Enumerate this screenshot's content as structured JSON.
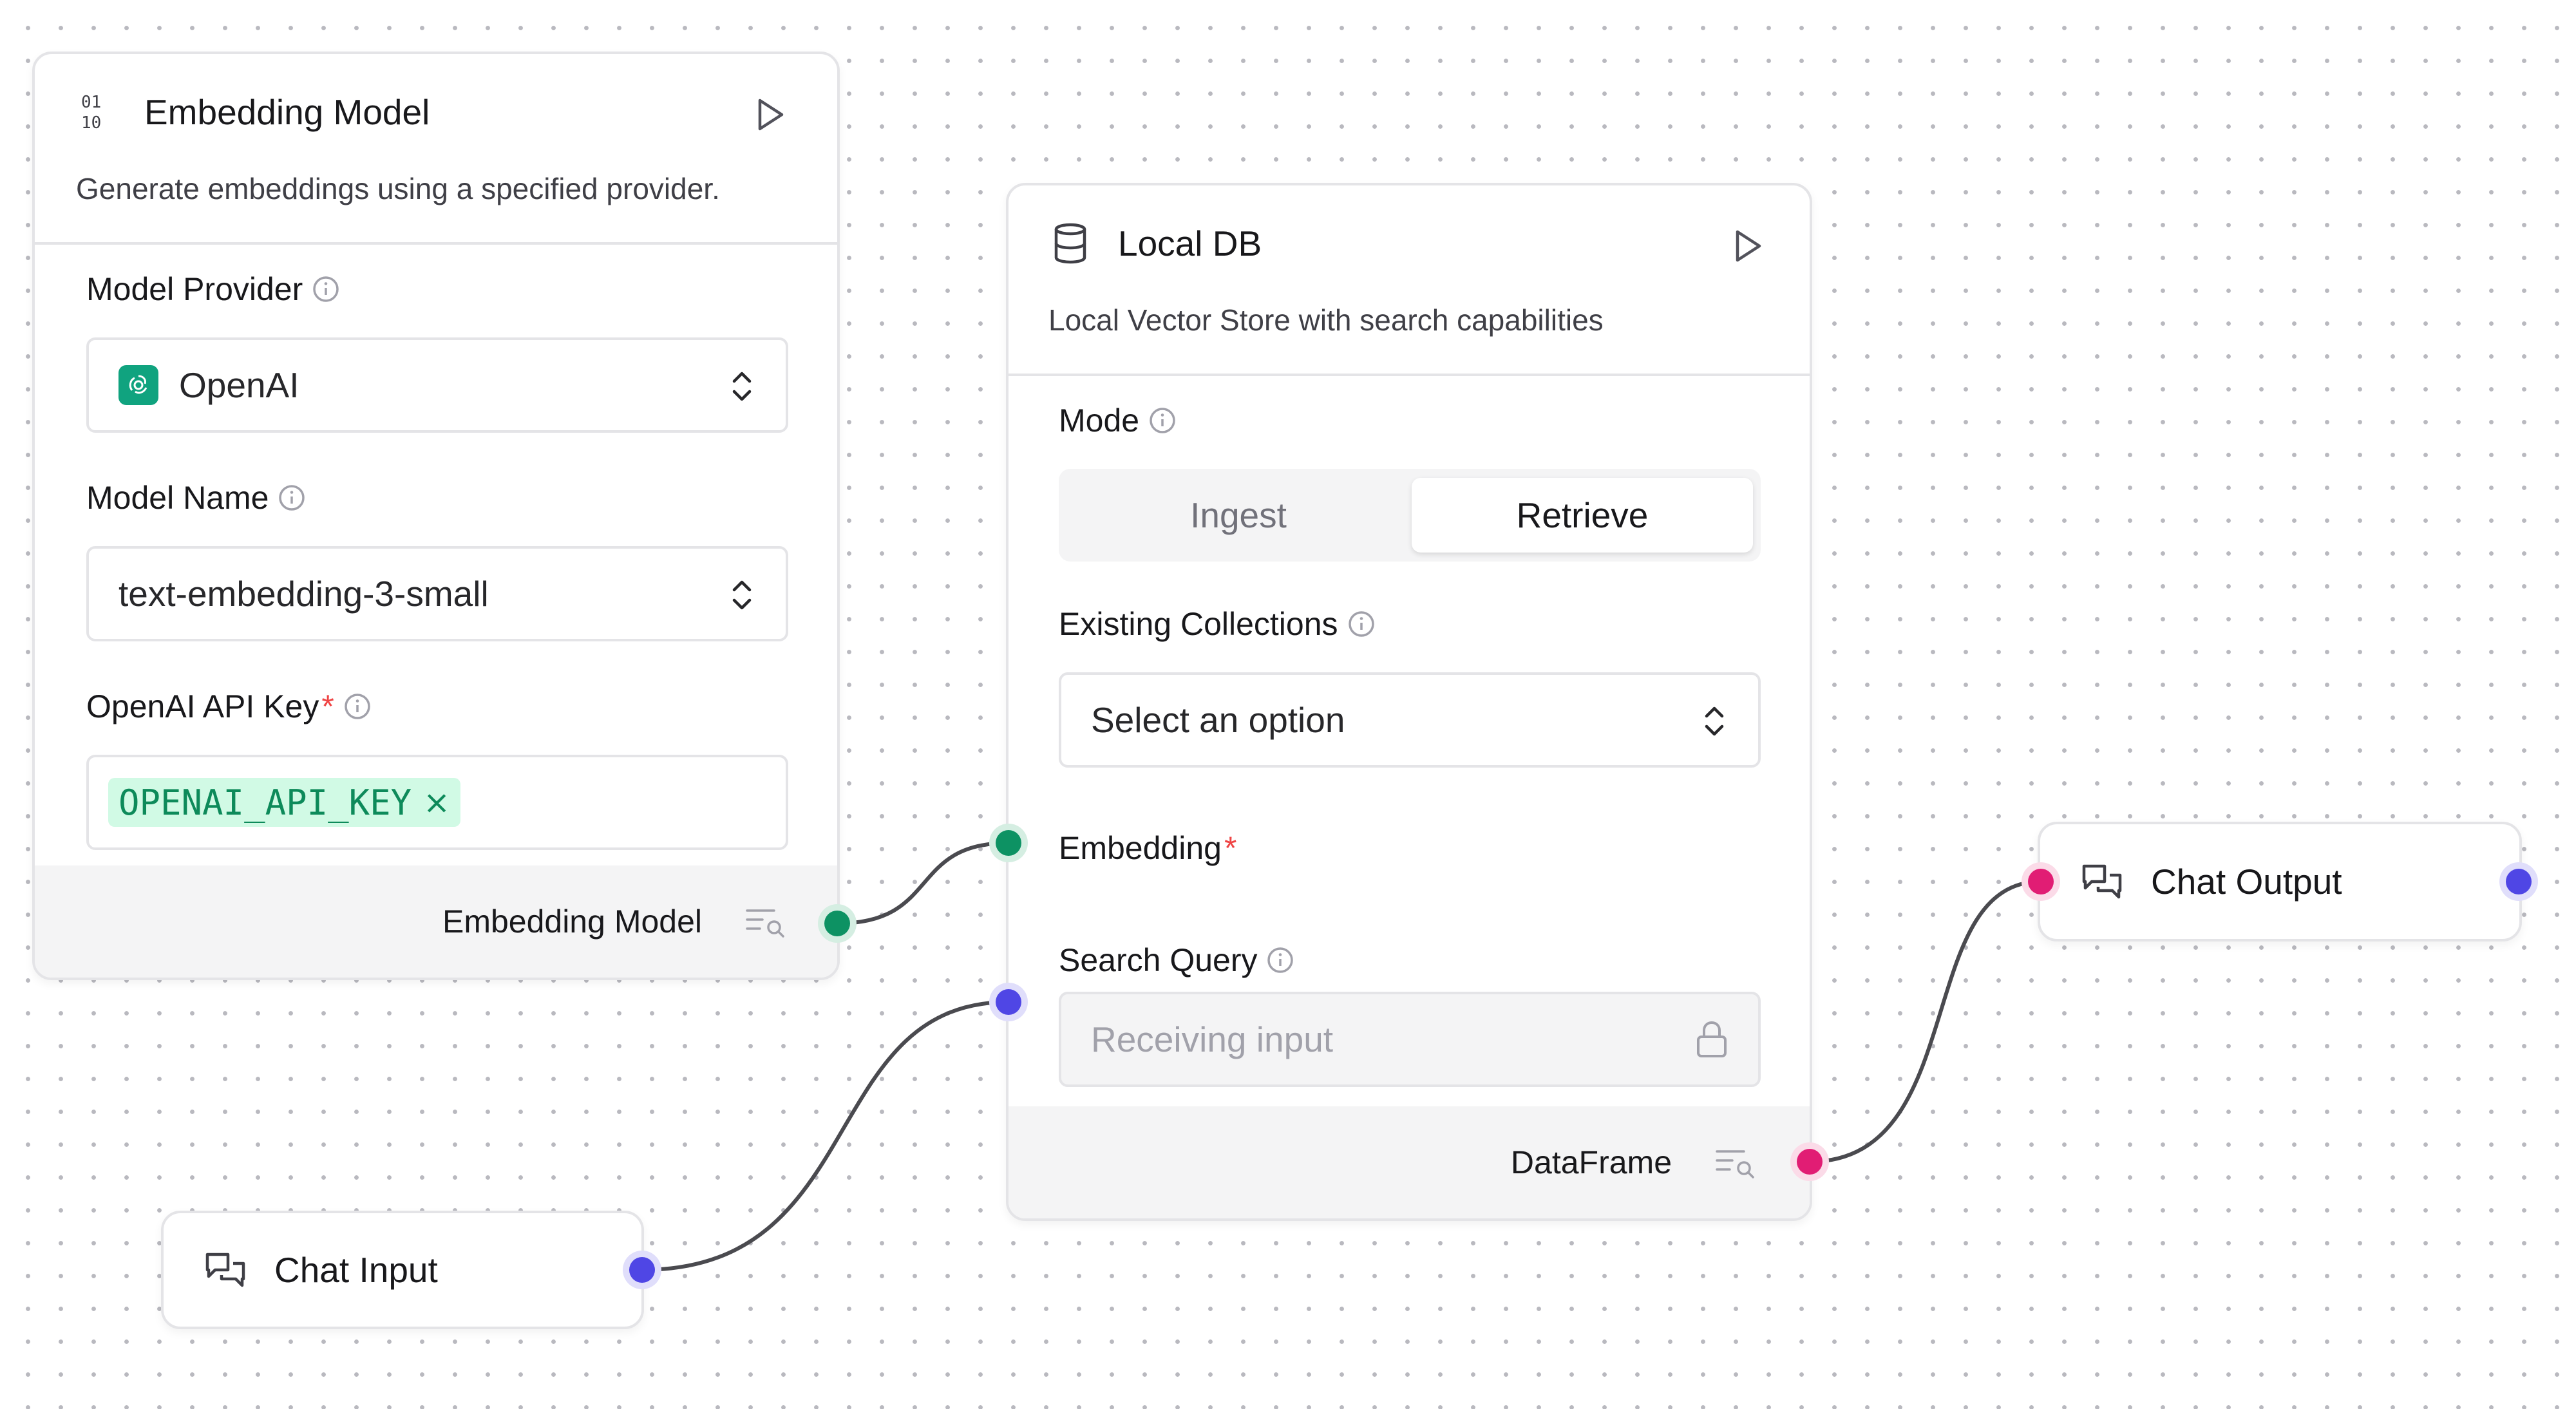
{
  "embedding_node": {
    "title": "Embedding Model",
    "description": "Generate embeddings using a specified provider.",
    "icon": "binary-icon",
    "fields": {
      "provider_label": "Model Provider",
      "provider_value": "OpenAI",
      "model_name_label": "Model Name",
      "model_name_value": "text-embedding-3-small",
      "api_key_label": "OpenAI API Key",
      "api_key_required": "*",
      "api_key_chip": "OPENAI_API_KEY",
      "api_key_chip_remove": "×"
    },
    "output_label": "Embedding Model"
  },
  "localdb_node": {
    "title": "Local DB",
    "description": "Local Vector Store with search capabilities",
    "icon": "database-icon",
    "mode_label": "Mode",
    "mode_options": [
      "Ingest",
      "Retrieve"
    ],
    "mode_selected": "Retrieve",
    "collections_label": "Existing Collections",
    "collections_placeholder": "Select an option",
    "embedding_label": "Embedding",
    "embedding_required": "*",
    "search_query_label": "Search Query",
    "search_query_placeholder": "Receiving input",
    "output_label": "DataFrame"
  },
  "chat_input_node": {
    "title": "Chat Input",
    "icon": "chat-bubbles-icon"
  },
  "chat_output_node": {
    "title": "Chat Output",
    "icon": "chat-bubbles-icon"
  },
  "colors": {
    "port_embedding": "#0d9263",
    "port_message": "#4f46e5",
    "port_dataframe": "#e11d74",
    "openai_brand": "#10a37f",
    "required": "#ef4444",
    "canvas_dot": "#b9b9bf",
    "edge": "#4a4a4f"
  }
}
